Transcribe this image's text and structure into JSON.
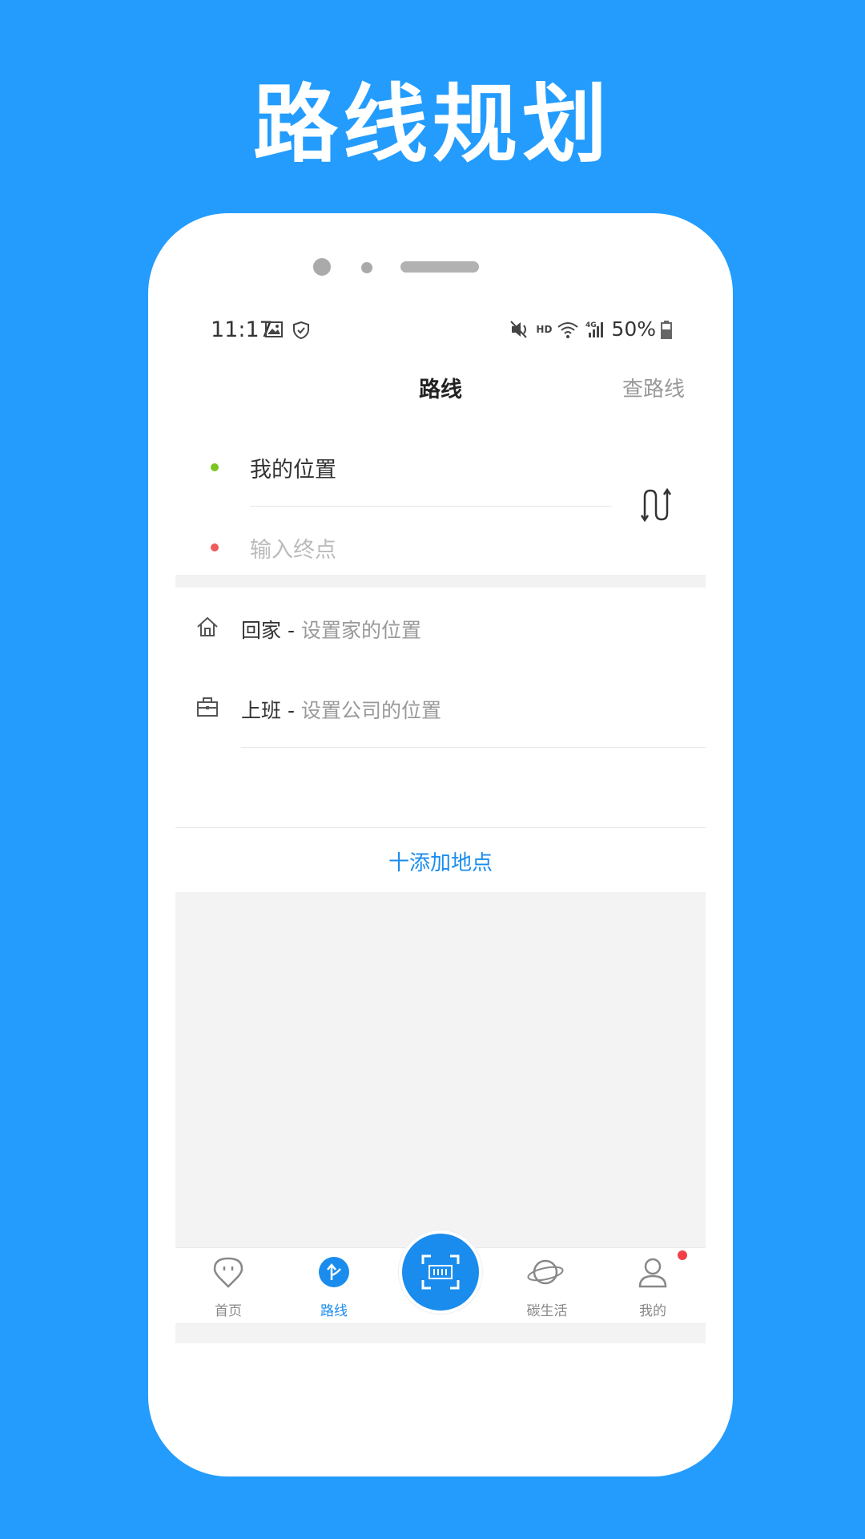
{
  "banner": {
    "title": "路线规划"
  },
  "colors": {
    "background": "#239cfd",
    "accent": "#1a8cee",
    "start_dot": "#7cc520",
    "end_dot": "#f05a5a"
  },
  "statusbar": {
    "time": "11:17",
    "battery": "50%",
    "icons": [
      "image-icon",
      "shield-icon",
      "mute-icon",
      "hd-icon",
      "wifi-icon",
      "4g-signal-icon",
      "battery-icon"
    ]
  },
  "header": {
    "title": "路线",
    "action": "查路线"
  },
  "route": {
    "start": "我的位置",
    "end_placeholder": "输入终点"
  },
  "places": [
    {
      "name": "回家",
      "separator": " - ",
      "hint": "设置家的位置",
      "icon": "home-icon"
    },
    {
      "name": "上班",
      "separator": " - ",
      "hint": "设置公司的位置",
      "icon": "briefcase-icon"
    }
  ],
  "add_place": "十添加地点",
  "tabs": [
    {
      "label": "首页",
      "icon": "home-face-icon",
      "active": false
    },
    {
      "label": "路线",
      "icon": "route-icon",
      "active": true
    },
    {
      "label": "",
      "icon": "scan-icon",
      "active": false
    },
    {
      "label": "碳生活",
      "icon": "planet-icon",
      "active": false
    },
    {
      "label": "我的",
      "icon": "person-icon",
      "active": false
    }
  ]
}
